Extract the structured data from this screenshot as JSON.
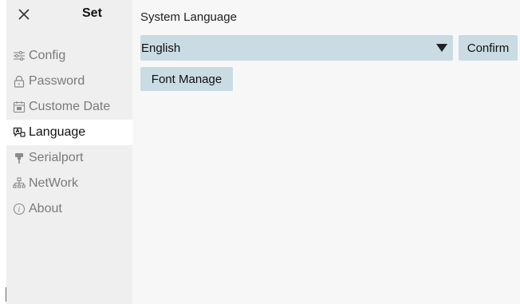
{
  "sidebar": {
    "title": "Set",
    "close_icon": "close-icon",
    "items": [
      {
        "label": "Config",
        "icon": "sliders-icon",
        "active": false
      },
      {
        "label": "Password",
        "icon": "lock-icon",
        "active": false
      },
      {
        "label": "Custome Date",
        "icon": "calendar-icon",
        "active": false
      },
      {
        "label": "Language",
        "icon": "language-icon",
        "active": true
      },
      {
        "label": "Serialport",
        "icon": "plug-icon",
        "active": false
      },
      {
        "label": "NetWork",
        "icon": "network-icon",
        "active": false
      },
      {
        "label": "About",
        "icon": "info-icon",
        "active": false
      }
    ]
  },
  "main": {
    "section_title": "System Language",
    "language_select": {
      "value": "English"
    },
    "confirm_label": "Confirm",
    "font_manage_label": "Font Manage"
  },
  "colors": {
    "sidebar_bg": "#efefef",
    "content_bg": "#f7f7f7",
    "control_bg": "#c9dbe3",
    "muted_text": "#7a7a7a"
  }
}
